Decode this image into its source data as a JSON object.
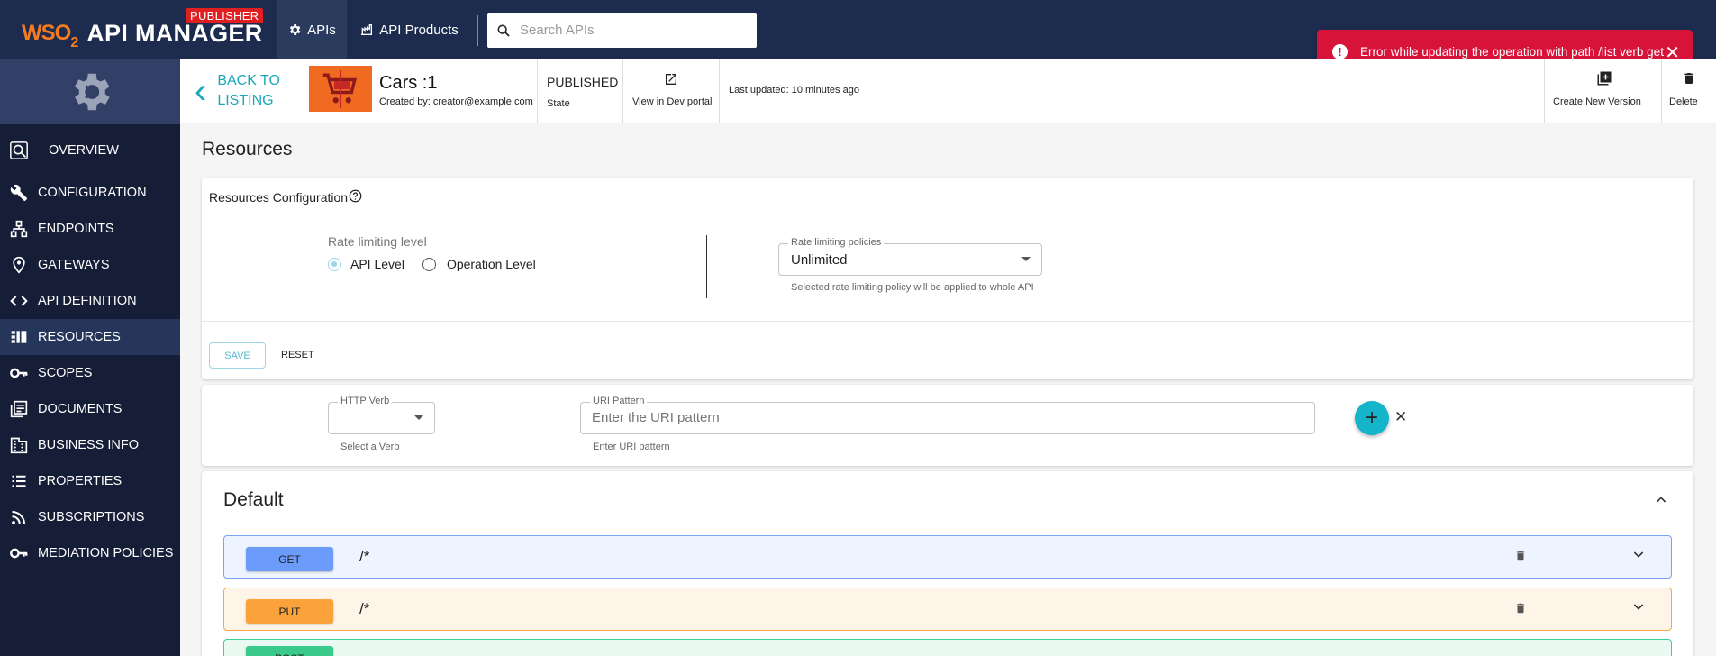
{
  "header": {
    "logo_wso": "WSO",
    "logo_two": "2",
    "logo_product": "API MANAGER",
    "badge": "PUBLISHER",
    "nav": [
      {
        "label": "APIs",
        "icon": "gear-icon"
      },
      {
        "label": "API Products",
        "icon": "products-icon"
      }
    ],
    "search_placeholder": "Search APIs"
  },
  "toast": {
    "message": "Error while updating the operation with path /list verb get",
    "close": "✕"
  },
  "sidebar": {
    "items": [
      {
        "label": "OVERVIEW",
        "icon": "overview-icon"
      },
      {
        "label": "CONFIGURATION",
        "icon": "wrench-icon"
      },
      {
        "label": "ENDPOINTS",
        "icon": "endpoints-icon"
      },
      {
        "label": "GATEWAYS",
        "icon": "location-icon"
      },
      {
        "label": "API DEFINITION",
        "icon": "code-icon"
      },
      {
        "label": "RESOURCES",
        "icon": "resources-icon",
        "active": true
      },
      {
        "label": "SCOPES",
        "icon": "key-icon"
      },
      {
        "label": "DOCUMENTS",
        "icon": "documents-icon"
      },
      {
        "label": "BUSINESS INFO",
        "icon": "building-icon"
      },
      {
        "label": "PROPERTIES",
        "icon": "list-icon"
      },
      {
        "label": "SUBSCRIPTIONS",
        "icon": "rss-icon"
      },
      {
        "label": "MEDIATION POLICIES",
        "icon": "key-icon"
      }
    ]
  },
  "api": {
    "back_line1": "BACK TO",
    "back_line2": "LISTING",
    "name": "Cars :1",
    "created_by": "Created by: creator@example.com",
    "state_value": "PUBLISHED",
    "state_label": "State",
    "dev_portal": "View in Dev portal",
    "last_updated": "Last updated: 10 minutes ago",
    "create_version": "Create New Version",
    "delete": "Delete"
  },
  "resources": {
    "title": "Resources",
    "config_title": "Resources Configuration",
    "rate_level_label": "Rate limiting level",
    "api_level": "API Level",
    "operation_level": "Operation Level",
    "selected_level": "API Level",
    "policy_legend": "Rate limiting policies",
    "policy_value": "Unlimited",
    "policy_helper": "Selected rate limiting policy will be applied to whole API",
    "save": "SAVE",
    "reset": "RESET"
  },
  "add_resource": {
    "verb_legend": "HTTP Verb",
    "verb_helper": "Select a Verb",
    "uri_legend": "URI Pattern",
    "uri_placeholder": "Enter the URI pattern",
    "uri_helper": "Enter URI pattern",
    "add": "+",
    "cancel": "✕"
  },
  "group": {
    "title": "Default",
    "operations": [
      {
        "verb": "GET",
        "path": "/*",
        "color": "#6c9cfb",
        "bg": "#eef4ff",
        "border": "#7ba3f2"
      },
      {
        "verb": "PUT",
        "path": "/*",
        "color": "#fba23b",
        "bg": "#fff4e8",
        "border": "#f5a64c"
      },
      {
        "verb": "POST",
        "path": "/*",
        "color": "#38c98b",
        "bg": "#eafaf2",
        "border": "#3fcf92"
      }
    ]
  }
}
